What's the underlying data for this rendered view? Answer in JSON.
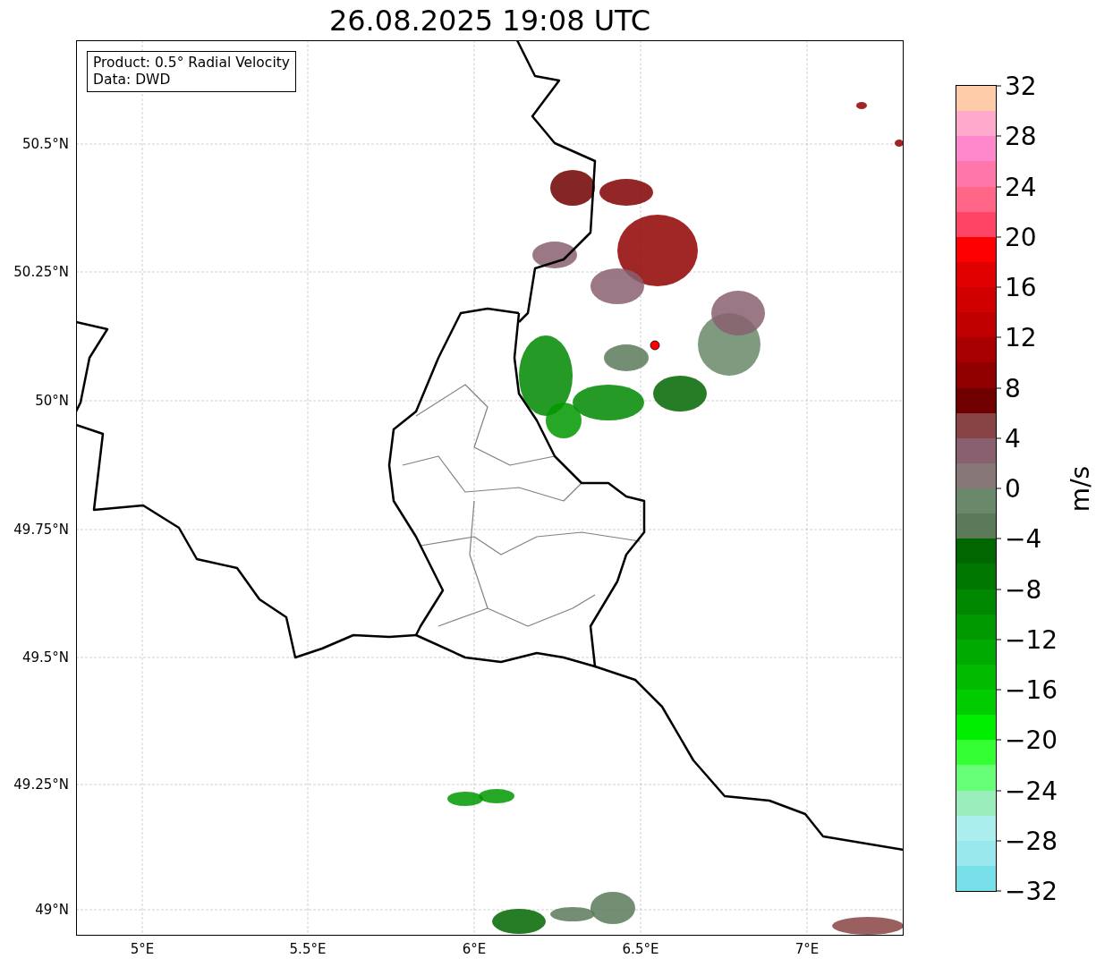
{
  "title": "26.08.2025 19:08 UTC",
  "info_box": {
    "lines": [
      "Product: 0.5° Radial Velocity",
      "Data: DWD"
    ]
  },
  "map": {
    "lat_ticks": [
      "50.5°N",
      "50.25°N",
      "50°N",
      "49.75°N",
      "49.5°N",
      "49.25°N",
      "49°N"
    ],
    "lon_ticks": [
      "5°E",
      "5.5°E",
      "6°E",
      "6.5°E",
      "7°E"
    ]
  },
  "colorbar": {
    "label": "m/s",
    "ticks": [
      "32",
      "28",
      "24",
      "20",
      "16",
      "12",
      "8",
      "4",
      "0",
      "−4",
      "−8",
      "−12",
      "−16",
      "−20",
      "−24",
      "−28",
      "−32"
    ],
    "bands": [
      {
        "color": "#ffccaa"
      },
      {
        "color": "#ffaacc"
      },
      {
        "color": "#ff88cc"
      },
      {
        "color": "#ff77aa"
      },
      {
        "color": "#ff6688"
      },
      {
        "color": "#ff4466"
      },
      {
        "color": "#ff0000"
      },
      {
        "color": "#e00000"
      },
      {
        "color": "#d00000"
      },
      {
        "color": "#c00000"
      },
      {
        "color": "#a80000"
      },
      {
        "color": "#900000"
      },
      {
        "color": "#700000"
      },
      {
        "color": "#884444"
      },
      {
        "color": "#886070"
      },
      {
        "color": "#887777"
      },
      {
        "color": "#6a886a"
      },
      {
        "color": "#5a7a5a"
      },
      {
        "color": "#006600"
      },
      {
        "color": "#007700"
      },
      {
        "color": "#008800"
      },
      {
        "color": "#009900"
      },
      {
        "color": "#00aa00"
      },
      {
        "color": "#00bb00"
      },
      {
        "color": "#00cc00"
      },
      {
        "color": "#00ee00"
      },
      {
        "color": "#33ff33"
      },
      {
        "color": "#66ff77"
      },
      {
        "color": "#99eebb"
      },
      {
        "color": "#aaeeee"
      },
      {
        "color": "#99e8ee"
      },
      {
        "color": "#77e0e8"
      }
    ]
  }
}
